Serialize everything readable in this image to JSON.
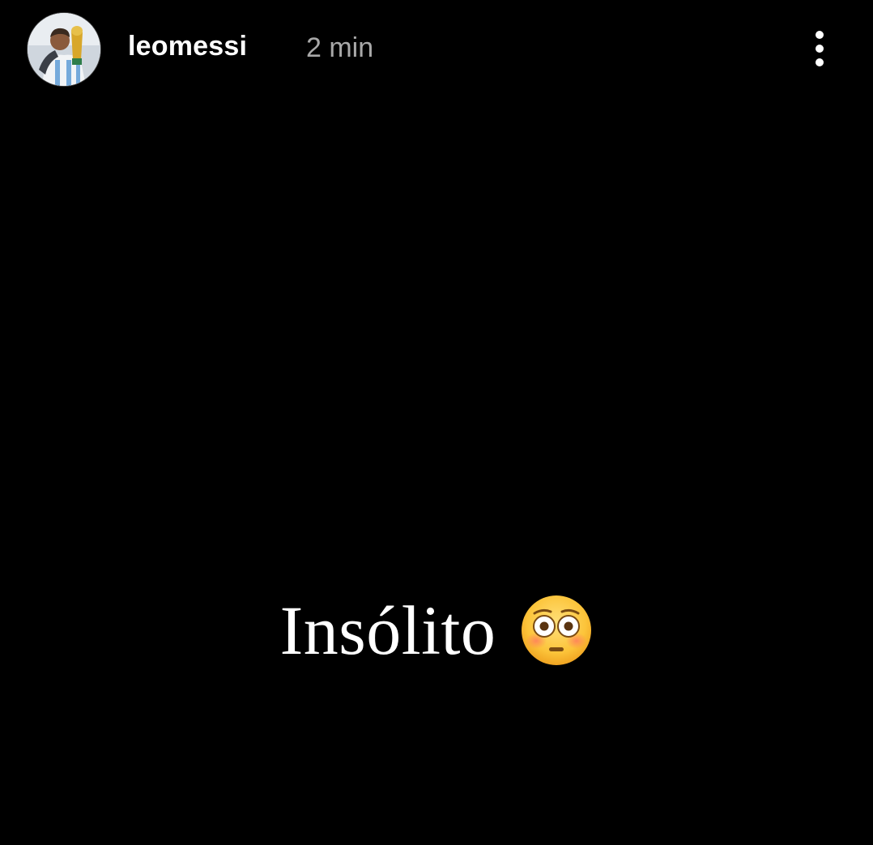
{
  "story": {
    "username": "leomessi",
    "timestamp": "2 min",
    "caption": "Insólito",
    "caption_emoji": "flushed-face-emoji"
  },
  "header": {
    "avatar_icon": "profile-avatar",
    "more_icon": "more-vertical-icon"
  },
  "colors": {
    "background": "#000000",
    "username": "#ffffff",
    "timestamp": "#a8a8a8",
    "caption": "#ffffff"
  }
}
